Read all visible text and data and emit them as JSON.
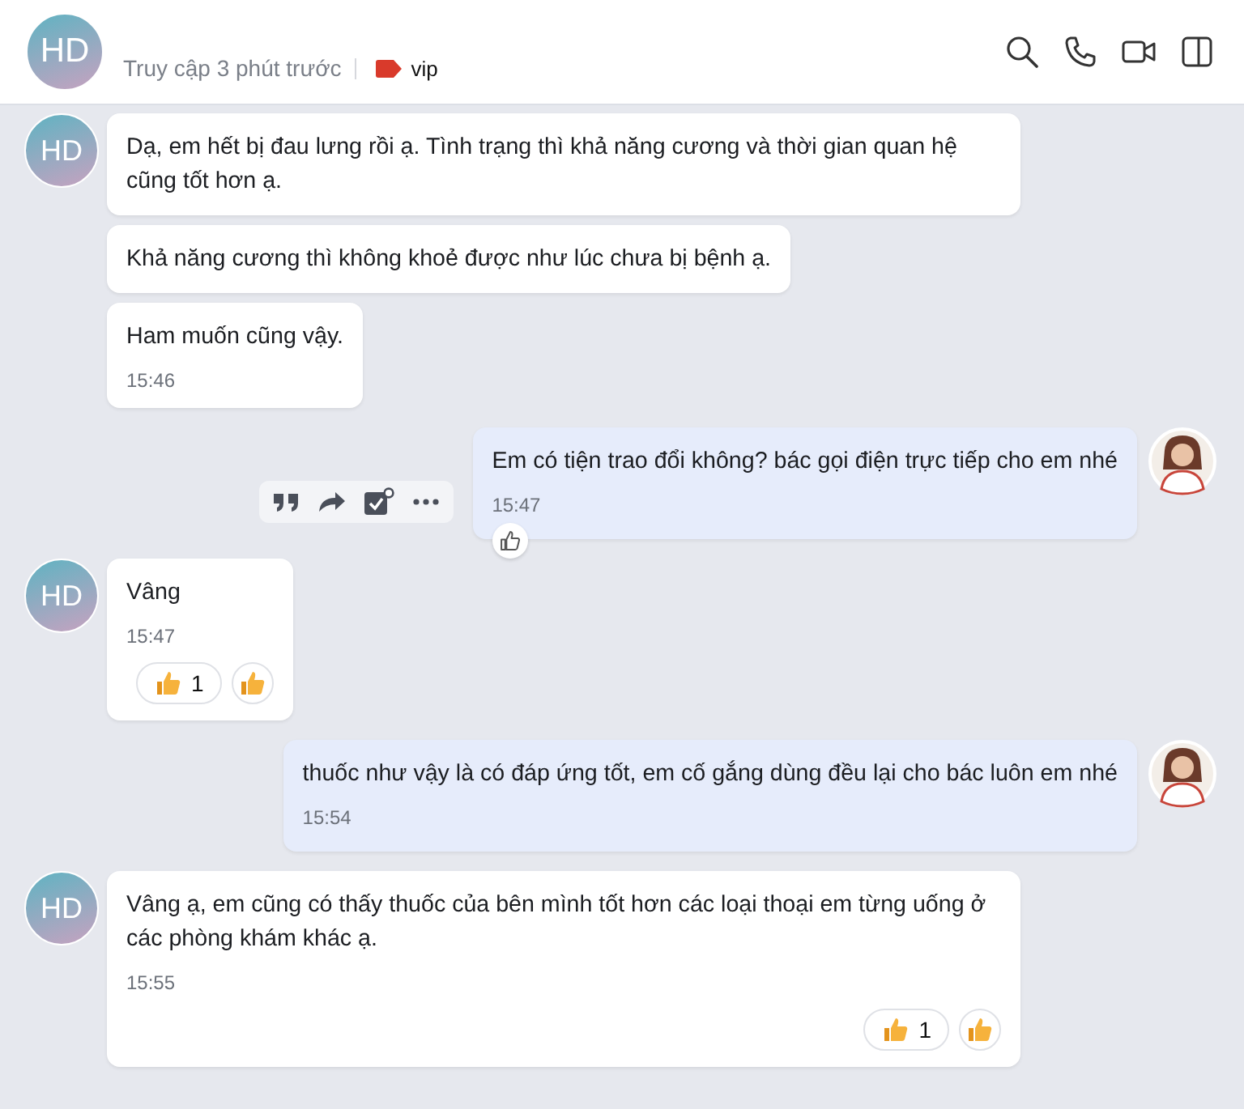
{
  "header": {
    "avatar": "HD",
    "status": "Truy cập 3 phút trước",
    "tag": {
      "label": "vip",
      "color": "#d93a2b"
    }
  },
  "messages": [
    {
      "kind": "in",
      "avatar": "HD",
      "text": "Dạ, em hết bị đau lưng rồi ạ. Tình trạng thì khả năng cương và thời gian quan hệ cũng tốt hơn ạ."
    },
    {
      "kind": "in",
      "text": "Khả năng cương thì không khoẻ được như lúc chưa bị bệnh ạ."
    },
    {
      "kind": "in",
      "text": "Ham muốn cũng vậy.",
      "time": "15:46"
    },
    {
      "kind": "out",
      "show_avatar": true,
      "text": "Em có tiện trao đổi không? bác gọi điện trực tiếp cho em nhé",
      "time": "15:47",
      "toolbar": true,
      "like_button": true
    },
    {
      "kind": "in",
      "avatar": "HD",
      "text": "Vâng",
      "time": "15:47",
      "reaction_count": "1"
    },
    {
      "kind": "out",
      "show_avatar": true,
      "text": "thuốc như vậy là có đáp ứng tốt, em cố gắng dùng đều lại cho bác luôn em nhé",
      "time": "15:54"
    },
    {
      "kind": "in",
      "avatar": "HD",
      "text": "Vâng ạ, em cũng có thấy thuốc của bên mình tốt hơn các loại thoại em từng uống ở các phòng khám khác ạ.",
      "time": "15:55",
      "reaction_count": "1"
    }
  ]
}
